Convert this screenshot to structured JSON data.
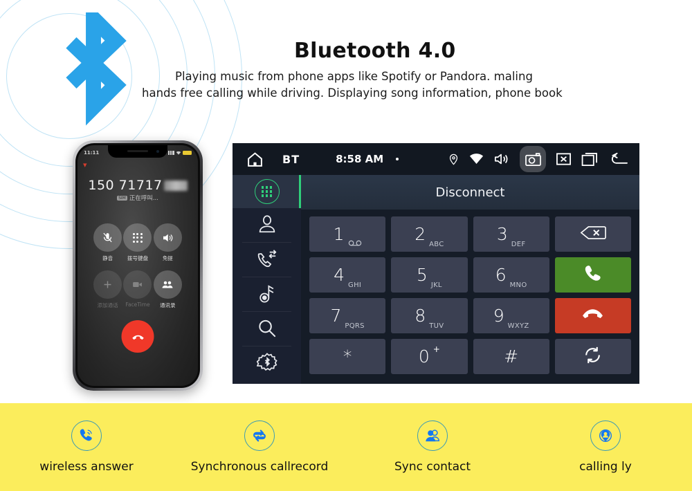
{
  "hero": {
    "title": "Bluetooth 4.0",
    "desc_line1": "Playing music from phone apps like Spotify or Pandora. maling",
    "desc_line2": "hands free calling while driving. Displaying  song information, phone book",
    "logo_icon": "bluetooth-logo-icon",
    "logo_color": "#2aa3e8",
    "ring_color": "#bfe3f5"
  },
  "phone": {
    "status_time": "11:11",
    "signal_icon": "signal-bars-icon",
    "wifi_icon": "wifi-icon",
    "battery_icon": "battery-icon",
    "collapse_icon": "chevron-down-icon",
    "number": "150 71717",
    "sim_tag": "SIM",
    "call_status": "正在呼叫...",
    "end_call_icon": "end-call-icon",
    "buttons": [
      {
        "label": "静音",
        "icon": "mute-icon",
        "disabled": false
      },
      {
        "label": "拨号键盘",
        "icon": "keypad-icon",
        "disabled": false
      },
      {
        "label": "免提",
        "icon": "speaker-icon",
        "disabled": false
      },
      {
        "label": "添加通话",
        "icon": "add-call-icon",
        "disabled": true
      },
      {
        "label": "FaceTime",
        "icon": "facetime-icon",
        "disabled": true
      },
      {
        "label": "通讯录",
        "icon": "contacts-icon",
        "disabled": false
      }
    ]
  },
  "unit": {
    "topbar": {
      "home_icon": "home-icon",
      "source_label": "BT",
      "time": "8:58 AM",
      "dot_icon": "dot-indicator-icon",
      "icons": [
        {
          "name": "location-pin-icon",
          "highlighted": false
        },
        {
          "name": "wifi-icon",
          "highlighted": false
        },
        {
          "name": "volume-icon",
          "highlighted": false
        },
        {
          "name": "camera-icon",
          "highlighted": true
        },
        {
          "name": "close-box-icon",
          "highlighted": false
        },
        {
          "name": "recent-apps-icon",
          "highlighted": false
        },
        {
          "name": "back-arrow-icon",
          "highlighted": false
        }
      ]
    },
    "sidebar": [
      {
        "name": "dialpad",
        "icon": "dialpad-icon",
        "active": true
      },
      {
        "name": "contacts",
        "icon": "contact-icon",
        "active": false
      },
      {
        "name": "call-log",
        "icon": "call-log-icon",
        "active": false
      },
      {
        "name": "music",
        "icon": "music-note-icon",
        "active": false
      },
      {
        "name": "search",
        "icon": "search-icon",
        "active": false
      },
      {
        "name": "bt-settings",
        "icon": "bluetooth-settings-icon",
        "active": false
      }
    ],
    "status_label": "Disconnect",
    "keys": [
      {
        "num": "1",
        "sub": "",
        "icon": "voicemail-icon",
        "type": "digit"
      },
      {
        "num": "2",
        "sub": "ABC",
        "type": "digit"
      },
      {
        "num": "3",
        "sub": "DEF",
        "type": "digit"
      },
      {
        "num": "",
        "sub": "",
        "icon": "backspace-icon",
        "type": "action"
      },
      {
        "num": "4",
        "sub": "GHI",
        "type": "digit"
      },
      {
        "num": "5",
        "sub": "JKL",
        "type": "digit"
      },
      {
        "num": "6",
        "sub": "MNO",
        "type": "digit"
      },
      {
        "num": "",
        "sub": "",
        "icon": "call-answer-icon",
        "type": "green"
      },
      {
        "num": "7",
        "sub": "PQRS",
        "type": "digit"
      },
      {
        "num": "8",
        "sub": "TUV",
        "type": "digit"
      },
      {
        "num": "9",
        "sub": "WXYZ",
        "type": "digit"
      },
      {
        "num": "",
        "sub": "",
        "icon": "call-end-icon",
        "type": "red"
      },
      {
        "num": "*",
        "sub": "",
        "type": "digit"
      },
      {
        "num": "0",
        "sub": "+",
        "type": "digit"
      },
      {
        "num": "#",
        "sub": "",
        "type": "digit"
      },
      {
        "num": "",
        "sub": "",
        "icon": "sync-icon",
        "type": "action"
      }
    ]
  },
  "features": {
    "background": "#fbed5c",
    "icon_color": "#1478f0",
    "ring_color": "#3a9ab5",
    "items": [
      {
        "label": "wireless answer",
        "icon": "call-waves-icon"
      },
      {
        "label": "Synchronous callrecord",
        "icon": "sync-loop-icon"
      },
      {
        "label": "Sync contact",
        "icon": "two-people-icon"
      },
      {
        "label": "calling ly",
        "icon": "person-pin-icon"
      }
    ]
  }
}
